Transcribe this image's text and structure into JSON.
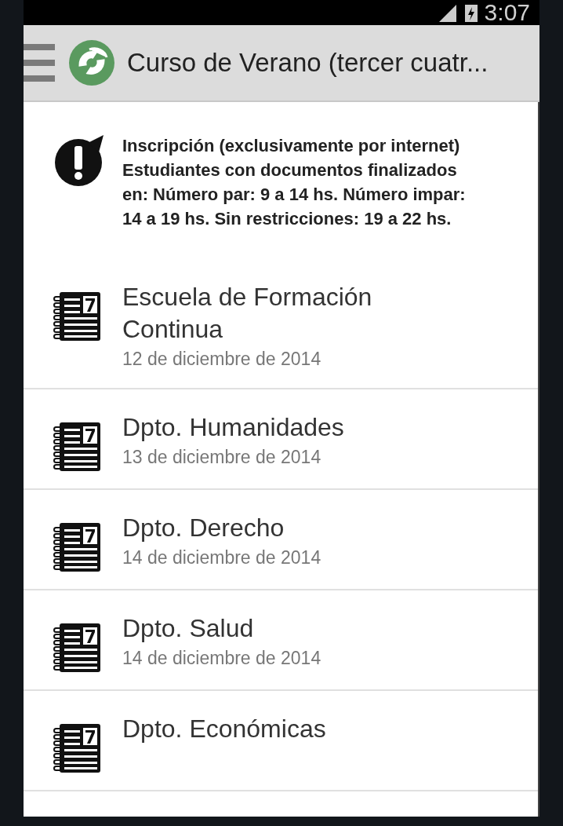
{
  "status_bar": {
    "time": "3:07"
  },
  "action_bar": {
    "title": "Curso de Verano (tercer cuatr..."
  },
  "notice": {
    "text": "Inscripción (exclusivamente por internet) Estudiantes con documentos finalizados en: Número par: 9 a 14 hs. Número impar: 14 a 19 hs. Sin restricciones: 19 a 22 hs."
  },
  "events": [
    {
      "title": "Escuela de Formación Continua",
      "date": "12 de diciembre de 2014"
    },
    {
      "title": "Dpto. Humanidades",
      "date": "13 de diciembre de 2014"
    },
    {
      "title": "Dpto. Derecho",
      "date": "14 de diciembre de 2014"
    },
    {
      "title": "Dpto. Salud",
      "date": "14 de diciembre de 2014"
    },
    {
      "title": "Dpto. Económicas"
    }
  ]
}
